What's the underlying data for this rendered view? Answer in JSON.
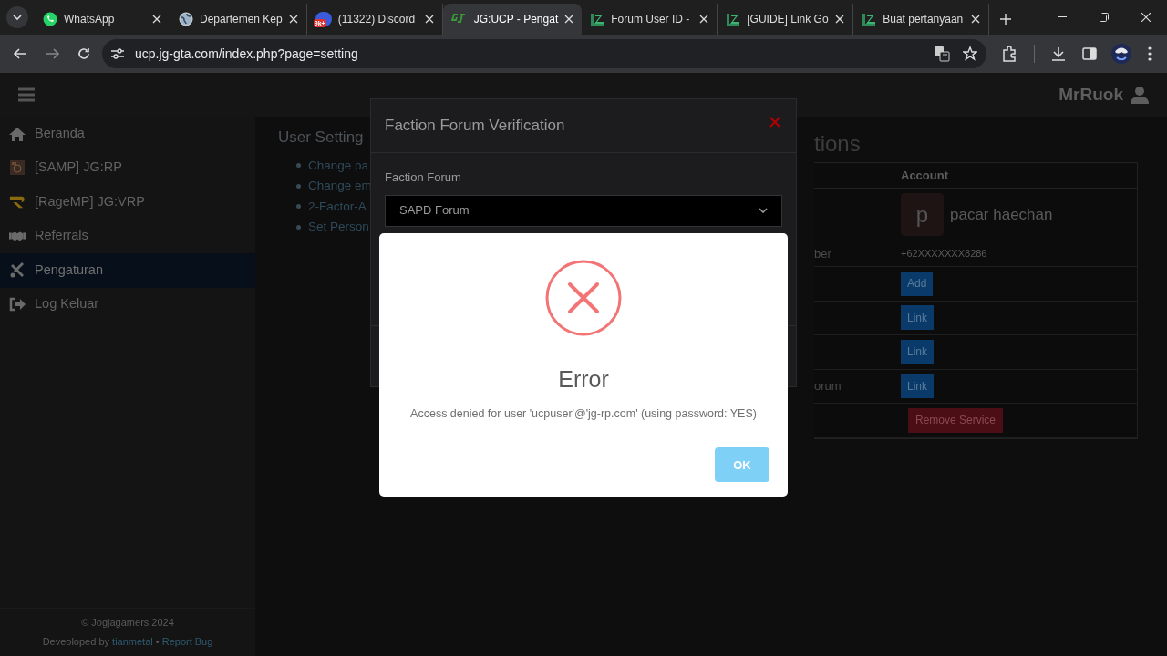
{
  "browser": {
    "tabs": [
      {
        "title": "WhatsApp",
        "selected": false
      },
      {
        "title": "Departemen Kep",
        "selected": false
      },
      {
        "badge": "9k+",
        "title": "(11322) Discord",
        "selected": false
      },
      {
        "title": "JG:UCP - Pengat",
        "selected": true
      },
      {
        "title": "Forum User ID -",
        "selected": false
      },
      {
        "title": "[GUIDE] Link Go",
        "selected": false
      },
      {
        "title": "Buat pertanyaan",
        "selected": false
      }
    ],
    "url": "ucp.jg-gta.com/index.php?page=setting"
  },
  "topbar": {
    "username": "MrRuok"
  },
  "sidebar": {
    "items": [
      {
        "label": "Beranda",
        "selected": false
      },
      {
        "label": "[SAMP] JG:RP",
        "selected": false
      },
      {
        "label": "[RageMP] JG:VRP",
        "selected": false
      },
      {
        "label": "Referrals",
        "selected": false
      },
      {
        "label": "Pengaturan",
        "selected": true
      },
      {
        "label": "Log Keluar",
        "selected": false
      }
    ],
    "footer": {
      "copyright": "© Jogjagamers 2024",
      "credit": "Deveoloped by",
      "author": "tianmetal",
      "separator": "•",
      "report": "Report Bug"
    }
  },
  "user_settings": {
    "title": "User Setting",
    "links": [
      "Change pa",
      "Change em",
      "2-Factor-A",
      "Set Person"
    ]
  },
  "associations": {
    "title": "tions",
    "header": "Account",
    "rows": [
      {
        "kind": "profile",
        "avatar": "p",
        "value": "pacar haechan"
      },
      {
        "kind": "text",
        "label": "ber",
        "value": "+62XXXXXXX8286"
      },
      {
        "kind": "button",
        "value": "Add"
      },
      {
        "kind": "button",
        "value": "Link"
      },
      {
        "kind": "button",
        "value": "Link"
      },
      {
        "kind": "button",
        "label": "orum",
        "value": "Link"
      },
      {
        "kind": "danger",
        "value": "Remove Service"
      }
    ]
  },
  "modal": {
    "title": "Faction Forum Verification",
    "field_label": "Faction Forum",
    "select_value": "SAPD Forum"
  },
  "error": {
    "title": "Error",
    "message": "Access denied for user 'ucpuser'@'jg-rp.com' (using password: YES)",
    "button": "OK"
  }
}
